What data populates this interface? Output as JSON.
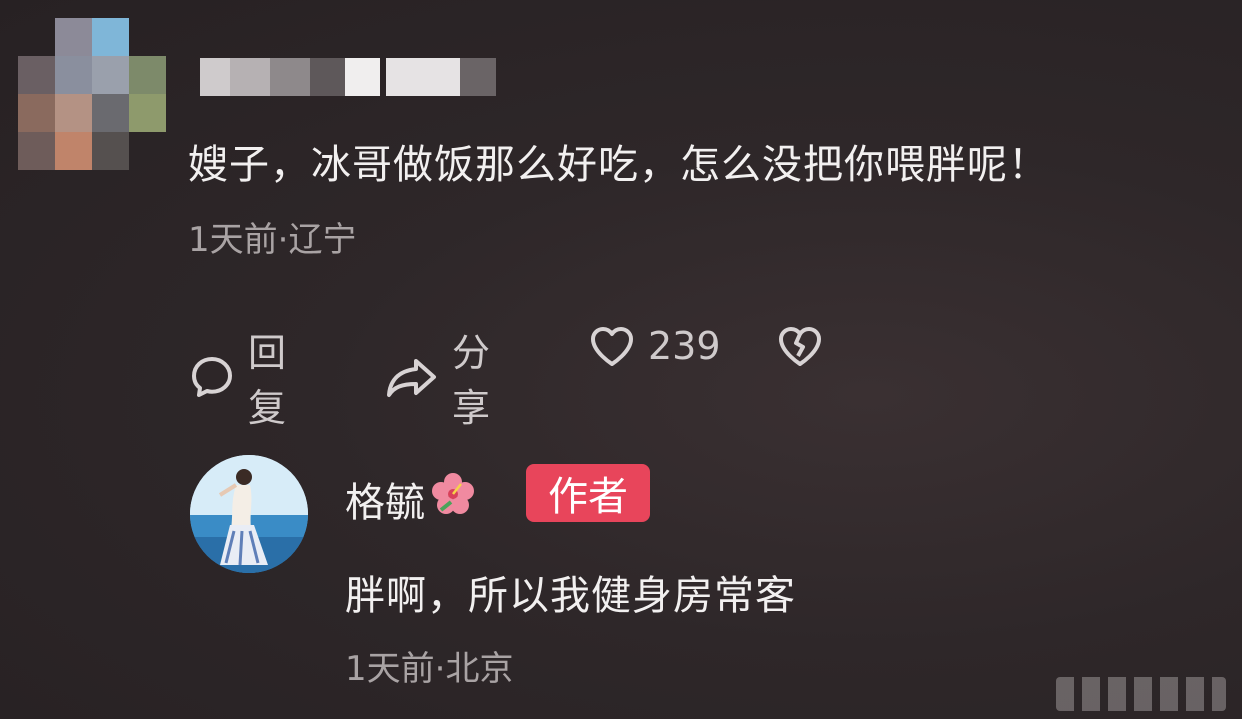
{
  "comment": {
    "text": "嫂子，冰哥做饭那么好吃，怎么没把你喂胖呢！",
    "meta": "1天前·辽宁",
    "actions": {
      "reply_label": "回复",
      "share_label": "分享",
      "like_count": "239"
    }
  },
  "reply": {
    "author_name": "格毓",
    "author_badge": "作者",
    "text": "胖啊，所以我健身房常客",
    "meta": "1天前·北京"
  },
  "colors": {
    "background": "#2e2729",
    "badge": "#e8455b",
    "meta_text": "#a9a3a4"
  },
  "icons": [
    "comment-bubble-icon",
    "share-arrow-icon",
    "heart-icon",
    "broken-heart-icon",
    "hibiscus-flower-icon"
  ]
}
